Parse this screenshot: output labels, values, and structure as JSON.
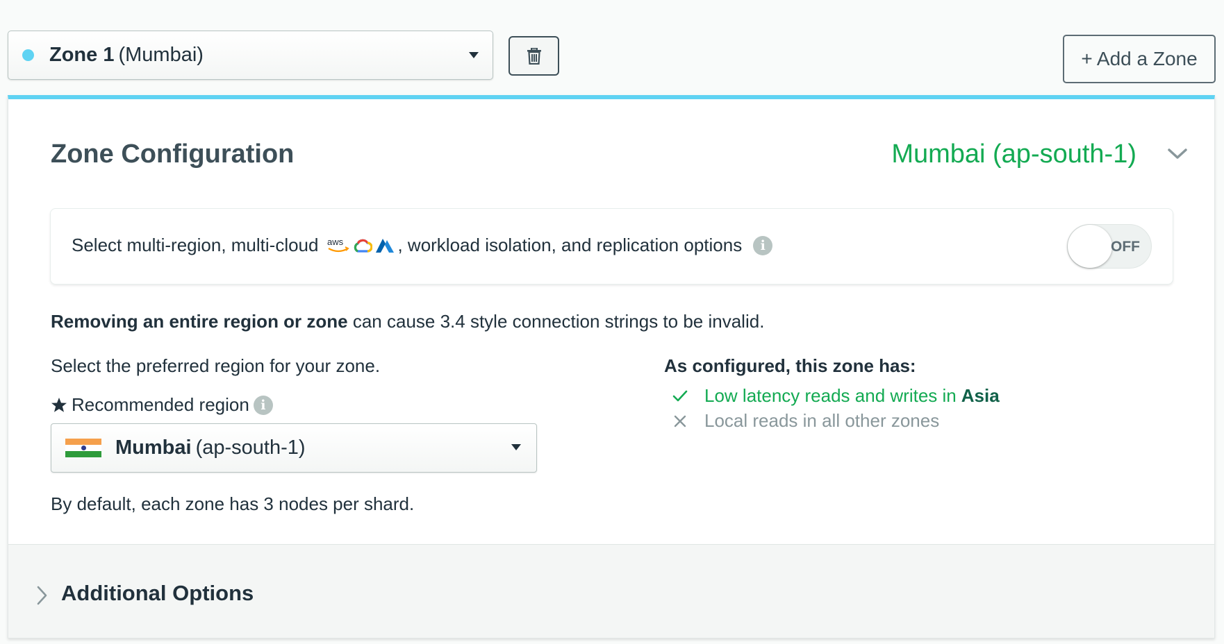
{
  "zone_selector": {
    "name": "Zone 1",
    "region": "(Mumbai)",
    "dot_color": "#5fd3f3"
  },
  "toolbar": {
    "delete_icon": "trash-icon",
    "add_zone_label": "+ Add a Zone"
  },
  "card": {
    "title": "Zone Configuration",
    "region_summary": "Mumbai (ap-south-1)",
    "accent_color": "#5fd3f3",
    "multi_region": {
      "text_before": "Select multi-region, multi-cloud",
      "text_after": ", workload isolation, and replication options",
      "cloud_icons": [
        "aws-icon",
        "google-cloud-icon",
        "azure-icon"
      ],
      "aws_label": "aws",
      "toggle_label": "OFF"
    },
    "warning": {
      "bold": "Removing an entire region or zone",
      "rest": " can cause 3.4 style connection strings to be invalid."
    },
    "preferred_region_label": "Select the preferred region for your zone.",
    "recommended_label": "Recommended region",
    "region_select": {
      "name": "Mumbai",
      "code": "(ap-south-1)",
      "flag": "india-flag-icon"
    },
    "default_nodes": "By default, each zone has 3 nodes per shard.",
    "configured": {
      "title": "As configured, this zone has:",
      "features": [
        {
          "text": "Low latency reads and writes in",
          "highlight": "Asia",
          "enabled": true
        },
        {
          "text": "Local reads in all other zones",
          "enabled": false
        }
      ]
    },
    "additional_options_label": "Additional Options"
  },
  "colors": {
    "success_green": "#13aa52",
    "dark_text": "#21313c",
    "muted_text": "#89979b"
  }
}
